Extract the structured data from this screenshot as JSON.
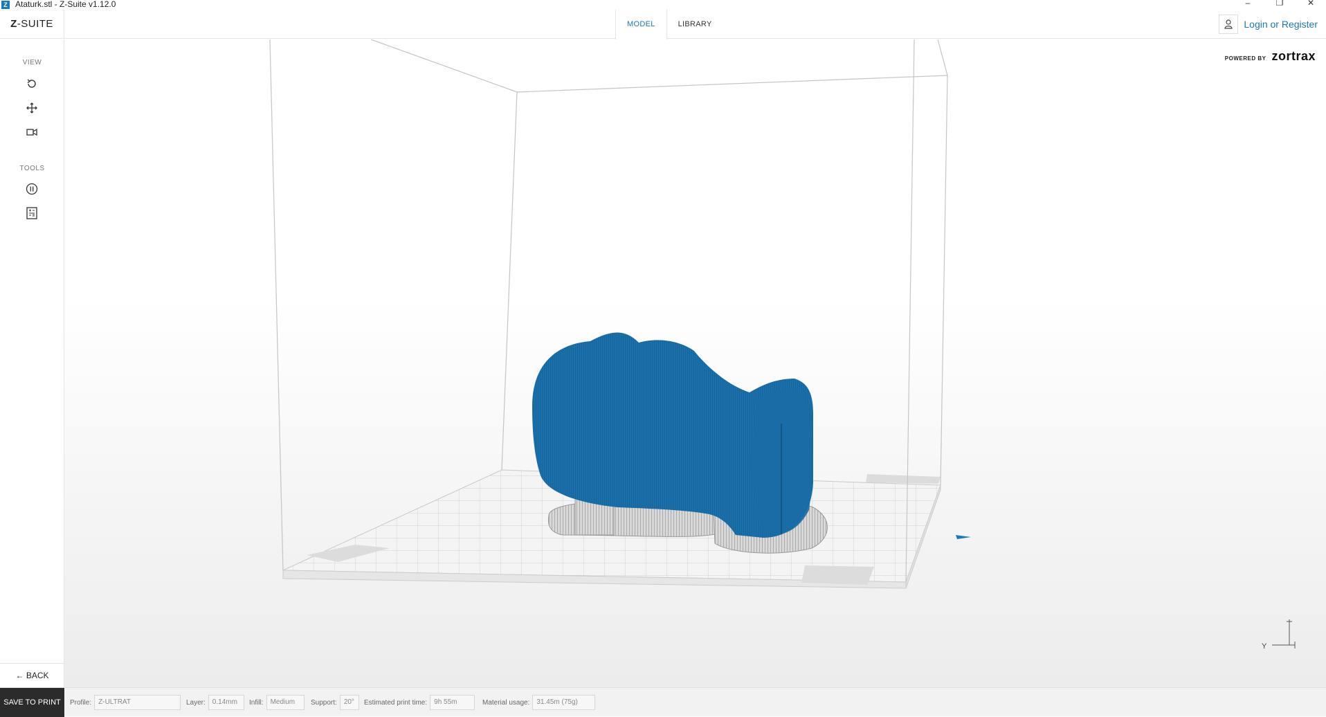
{
  "window": {
    "title": "Ataturk.stl - Z-Suite v1.12.0",
    "minimize": "–",
    "maximize": "❐",
    "close": "✕"
  },
  "header": {
    "brand_prefix": "Z",
    "brand_suffix": "-SUITE",
    "tabs": [
      {
        "label": "MODEL",
        "active": true
      },
      {
        "label": "LIBRARY",
        "active": false
      }
    ],
    "login_label": "Login or Register"
  },
  "sidebar": {
    "view_label": "VIEW",
    "tools_label": "TOOLS",
    "view_icons": [
      "rotate-icon",
      "move-icon",
      "camera-icon"
    ],
    "tool_icons": [
      "pause-layer-icon",
      "calculator-icon"
    ],
    "back_label": "BACK"
  },
  "viewport": {
    "powered_by": "POWERED BY",
    "brand_logo": "zortrax",
    "model_color": "#1a70aa",
    "axis_y": "Y"
  },
  "statusbar": {
    "save_label": "SAVE TO PRINT",
    "profile_label": "Profile:",
    "profile_value": "Z-ULTRAT",
    "layer_label": "Layer:",
    "layer_value": "0.14mm",
    "infill_label": "Infill:",
    "infill_value": "Medium",
    "support_label": "Support:",
    "support_value": "20°",
    "time_label": "Estimated print time:",
    "time_value": "9h 55m",
    "material_label": "Material usage:",
    "material_value": "31.45m (75g)"
  }
}
